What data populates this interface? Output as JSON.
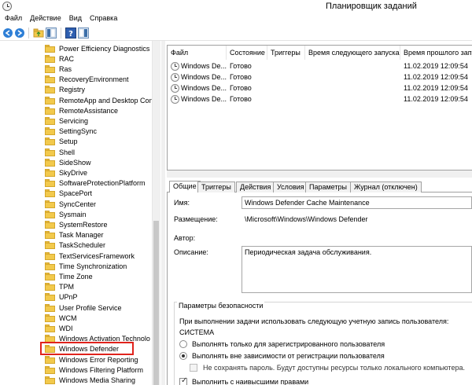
{
  "window": {
    "title": "Планировщик заданий"
  },
  "menu": [
    "Файл",
    "Действие",
    "Вид",
    "Справка"
  ],
  "toolbar": {
    "back_icon": "arrow-left-icon",
    "forward_icon": "arrow-right-icon",
    "up_icon": "folder-up-icon",
    "show_hide_icon": "console-tree-icon",
    "help_icon": "help-icon",
    "action_pane_icon": "action-pane-icon"
  },
  "tree": {
    "items": [
      "Power Efficiency Diagnostics",
      "RAC",
      "Ras",
      "RecoveryEnvironment",
      "Registry",
      "RemoteApp and Desktop Con",
      "RemoteAssistance",
      "Servicing",
      "SettingSync",
      "Setup",
      "Shell",
      "SideShow",
      "SkyDrive",
      "SoftwareProtectionPlatform",
      "SpacePort",
      "SyncCenter",
      "Sysmain",
      "SystemRestore",
      "Task Manager",
      "TaskScheduler",
      "TextServicesFramework",
      "Time Synchronization",
      "Time Zone",
      "TPM",
      "UPnP",
      "User Profile Service",
      "WCM",
      "WDI",
      "Windows Activation Technolo",
      "Windows Defender",
      "Windows Error Reporting",
      "Windows Filtering Platform",
      "Windows Media Sharing"
    ],
    "selected": "Windows Defender",
    "highlight_color": "#e0231c"
  },
  "tasklist": {
    "columns": [
      "Файл",
      "Состояние",
      "Триггеры",
      "Время следующего запуска",
      "Время прошлого запу"
    ],
    "rows": [
      {
        "name": "Windows De...",
        "status": "Готово",
        "triggers": "",
        "next": "",
        "last": "11.02.2019 12:09:54"
      },
      {
        "name": "Windows De...",
        "status": "Готово",
        "triggers": "",
        "next": "",
        "last": "11.02.2019 12:09:54"
      },
      {
        "name": "Windows De...",
        "status": "Готово",
        "triggers": "",
        "next": "",
        "last": "11.02.2019 12:09:54"
      },
      {
        "name": "Windows De...",
        "status": "Готово",
        "triggers": "",
        "next": "",
        "last": "11.02.2019 12:09:54"
      }
    ]
  },
  "tabs": [
    "Общие",
    "Триггеры",
    "Действия",
    "Условия",
    "Параметры",
    "Журнал (отключен)"
  ],
  "active_tab": "Общие",
  "general": {
    "name_label": "Имя:",
    "name_value": "Windows Defender Cache Maintenance",
    "location_label": "Размещение:",
    "location_value": "\\Microsoft\\Windows\\Windows Defender",
    "author_label": "Автор:",
    "author_value": "",
    "description_label": "Описание:",
    "description_value": "Периодическая задача обслуживания.",
    "security_group_title": "Параметры безопасности",
    "run_as_text": "При выполнении задачи использовать следующую учетную запись пользователя:",
    "account": "СИСТЕМА",
    "option_logged_on": "Выполнять только для зарегистрированного пользователя",
    "option_whether_logged": "Выполнять вне зависимости от регистрации пользователя",
    "option_no_store_password": "Не сохранять пароль. Будут доступны ресурсы только локального компьютера.",
    "option_highest": "Выполнить с наивысшими правами"
  }
}
